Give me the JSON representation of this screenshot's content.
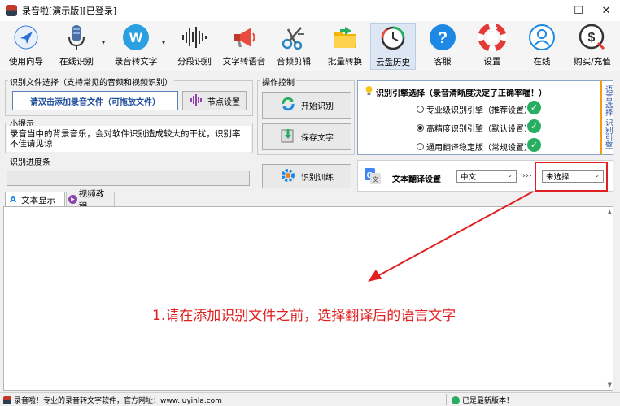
{
  "window": {
    "title": "录音啦[演示版][已登录]",
    "minimize": "—",
    "maximize": "☐",
    "close": "✕"
  },
  "toolbar": {
    "items": [
      {
        "label": "使用向导",
        "icon": "navigation-arrow-icon"
      },
      {
        "label": "在线识别",
        "icon": "microphone-icon"
      },
      {
        "label": "录音转文字",
        "icon": "w-logo-icon"
      },
      {
        "label": "分段识别",
        "icon": "waveform-icon"
      },
      {
        "label": "文字转语音",
        "icon": "megaphone-icon"
      },
      {
        "label": "音频剪辑",
        "icon": "scissors-icon"
      },
      {
        "label": "批量转换",
        "icon": "folder-icon"
      },
      {
        "label": "云盘历史",
        "icon": "history-clock-icon"
      },
      {
        "label": "客服",
        "icon": "help-icon"
      },
      {
        "label": "设置",
        "icon": "lifebuoy-icon"
      },
      {
        "label": "在线",
        "icon": "user-icon"
      },
      {
        "label": "购买/充值",
        "icon": "dollar-icon"
      }
    ],
    "dropdown_glyph": "▾"
  },
  "file_select": {
    "group_label": "识别文件选择（支持常见的音频和视频识别）",
    "add_button": "请双击添加录音文件（可拖放文件）",
    "node_button": "节点设置"
  },
  "tips": {
    "group_label": "小提示",
    "text": "录音当中的背景音乐，会对软件识别造成较大的干扰，识别率不佳请见谅"
  },
  "progress": {
    "group_label": "识别进度条",
    "value": 0
  },
  "control": {
    "group_label": "操作控制",
    "start_button": "开始识别",
    "save_button": "保存文字",
    "train_button": "识别训练"
  },
  "engine": {
    "title": "识别引擎选择（录音清晰度决定了正确率喔！）",
    "options": [
      {
        "label": "专业级识别引擎（推荐设置）",
        "selected": false
      },
      {
        "label": "高精度识别引擎（默认设置）",
        "selected": true
      },
      {
        "label": "通用翻译稳定版（常规设置）",
        "selected": false
      }
    ],
    "check_glyph": "✓",
    "side_tabs": "语言选择 识别引擎"
  },
  "translate": {
    "label": "文本翻译设置",
    "source": "中文",
    "separator": "›››",
    "target": "未选择",
    "arrow": "⌄"
  },
  "tabs": [
    {
      "label": "文本显示",
      "active": true
    },
    {
      "label": "视频教程",
      "active": false
    }
  ],
  "annotation": {
    "text": "1.请在添加识别文件之前，选择翻译后的语言文字",
    "color": "#e02020"
  },
  "status": {
    "left": "录音啦！专业的录音转文字软件，官方网址：www.luyinla.com",
    "right": "已是最新版本！"
  }
}
